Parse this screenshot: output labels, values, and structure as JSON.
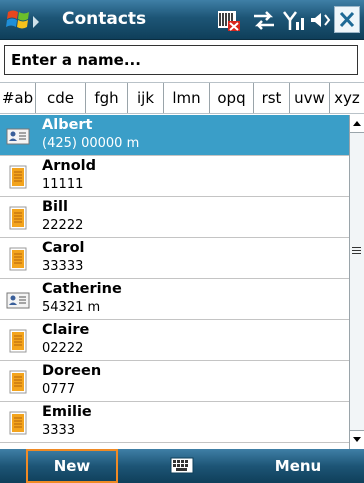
{
  "window": {
    "title": "Contacts"
  },
  "search": {
    "placeholder": "Enter a name..."
  },
  "alphabet_tabs": [
    "#ab",
    "cde",
    "fgh",
    "ijk",
    "lmn",
    "opq",
    "rst",
    "uvw",
    "xyz"
  ],
  "contacts": [
    {
      "name": "Albert",
      "detail": "(425) 00000  m",
      "icon": "sim-contact-icon",
      "selected": true
    },
    {
      "name": "Arnold",
      "detail": "11111",
      "icon": "contact-card-icon",
      "selected": false
    },
    {
      "name": "Bill",
      "detail": "22222",
      "icon": "contact-card-icon",
      "selected": false
    },
    {
      "name": "Carol",
      "detail": "33333",
      "icon": "contact-card-icon",
      "selected": false
    },
    {
      "name": "Catherine",
      "detail": "54321  m",
      "icon": "sim-contact-icon",
      "selected": false
    },
    {
      "name": "Claire",
      "detail": "02222",
      "icon": "contact-card-icon",
      "selected": false
    },
    {
      "name": "Doreen",
      "detail": "0777",
      "icon": "contact-card-icon",
      "selected": false
    },
    {
      "name": "Emilie",
      "detail": "3333",
      "icon": "contact-card-icon",
      "selected": false
    }
  ],
  "softkeys": {
    "left": "New",
    "right": "Menu"
  },
  "colors": {
    "titlebar": "#1d5576",
    "selection": "#3a9ec8",
    "softkey_focus": "#f08a24"
  }
}
